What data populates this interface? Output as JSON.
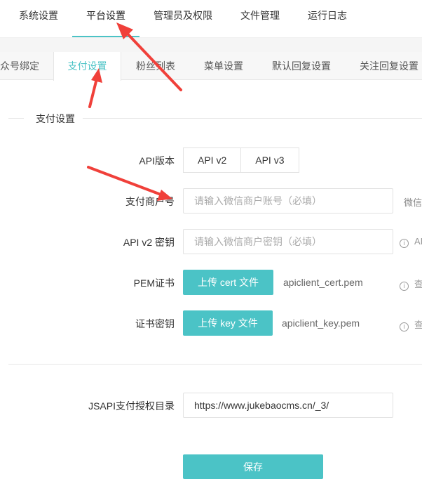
{
  "topnav": {
    "items": [
      "系统设置",
      "平台设置",
      "管理员及权限",
      "文件管理",
      "运行日志"
    ],
    "active_index": 1
  },
  "subtabs": {
    "items": [
      "众号绑定",
      "支付设置",
      "粉丝列表",
      "菜单设置",
      "默认回复设置",
      "关注回复设置"
    ],
    "active_index": 1
  },
  "section": {
    "title": "支付设置"
  },
  "form": {
    "api_version": {
      "label": "API版本",
      "options": [
        "API v2",
        "API v3"
      ]
    },
    "merchant_id": {
      "label": "支付商户号",
      "placeholder": "请输入微信商户账号（必填）",
      "hint": "微信"
    },
    "api_v2_key": {
      "label": "API v2 密钥",
      "placeholder": "请输入微信商户密钥（必填）",
      "hint": "AI"
    },
    "pem_cert": {
      "label": "PEM证书",
      "button": "上传 cert 文件",
      "file": "apiclient_cert.pem",
      "hint": "查"
    },
    "cert_key": {
      "label": "证书密钥",
      "button": "上传 key 文件",
      "file": "apiclient_key.pem",
      "hint": "查"
    },
    "jsapi_dir": {
      "label": "JSAPI支付授权目录",
      "value": "https://www.jukebaocms.cn/_3/"
    },
    "save_label": "保存"
  },
  "icons": {
    "info": "info-circle-icon"
  },
  "colors": {
    "accent": "#4bc3c6",
    "arrow": "#f0403a"
  }
}
